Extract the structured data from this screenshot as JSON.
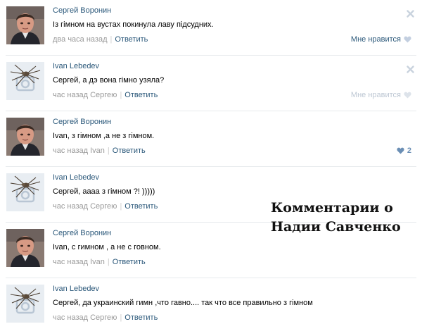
{
  "comments": [
    {
      "author": "Сергей Воронин",
      "avatar": "man-photo",
      "text": "Із гімном на вустах покинула лаву підсудних.",
      "time": "два часа назад",
      "reply": "Ответить",
      "like_label": "Мне нравится",
      "like_count": "",
      "like_style": "normal",
      "show_close": true
    },
    {
      "author": "Ivan Lebedev",
      "avatar": "spider-camera",
      "text": "Сергей, а дэ вона гімно узяла?",
      "time": "час назад Сергею",
      "reply": "Ответить",
      "like_label": "Мне нравится",
      "like_count": "",
      "like_style": "faded",
      "show_close": true
    },
    {
      "author": "Сергей Воронин",
      "avatar": "man-photo",
      "text": "Ivan, з гімном ,а не з гімном.",
      "time": "час назад Ivan",
      "reply": "Ответить",
      "like_label": "",
      "like_count": "2",
      "like_style": "count",
      "show_close": false
    },
    {
      "author": "Ivan Lebedev",
      "avatar": "spider-camera",
      "text": "Сергей, аааа з гімном ?! )))))",
      "time": "час назад Сергею",
      "reply": "Ответить",
      "like_label": "",
      "like_count": "",
      "like_style": "none",
      "show_close": false
    },
    {
      "author": "Сергей Воронин",
      "avatar": "man-photo",
      "text": "Ivan, с гимном , а не с говном.",
      "time": "час назад Ivan",
      "reply": "Ответить",
      "like_label": "",
      "like_count": "",
      "like_style": "none",
      "show_close": false
    },
    {
      "author": "Ivan Lebedev",
      "avatar": "spider-camera",
      "text": "Сергей, да украинский гимн ,что гавно.... так что все правильно з гімном",
      "time": "час назад Сергею",
      "reply": "Ответить",
      "like_label": "",
      "like_count": "",
      "like_style": "none",
      "show_close": false
    }
  ],
  "caption": {
    "line1": "Комментарии  о",
    "line2": "Надии Савченко"
  },
  "colors": {
    "link": "#2b587a",
    "meta": "#999999",
    "like_heart": "#c3cfe0",
    "divider": "#e7eaed"
  }
}
